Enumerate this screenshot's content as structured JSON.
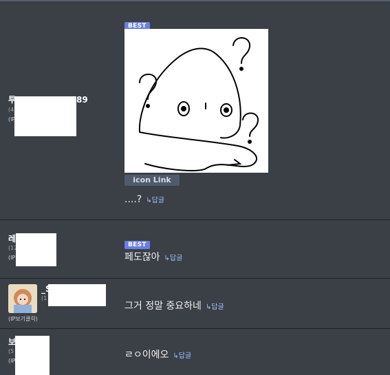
{
  "rows": [
    {
      "user": {
        "name": "투",
        "name_suffix": "89",
        "meta": "(4",
        "ip": "(IP"
      },
      "best_label": "BEST",
      "image_label": "icon Link",
      "text": "....?",
      "reply": "↳답글"
    },
    {
      "user": {
        "name": "레",
        "meta": "(12",
        "ip": "(IP"
      },
      "best_label": "BEST",
      "text": "페도잖아",
      "reply": "↳답글"
    },
    {
      "user": {
        "name": "_S",
        "meta": "(1",
        "ip": "(IP보기클릭)"
      },
      "text": "그거 정말 중요하네",
      "reply": "↳답글"
    },
    {
      "user": {
        "name": "보",
        "meta": "(5",
        "ip": "(IP"
      },
      "text": "ㄹㅇ이에오",
      "reply": "↳답글"
    }
  ],
  "colors": {
    "background": "#3b3f46",
    "best_badge": "#6b7fe0",
    "reply_link": "#9fc3ff"
  },
  "icons": [
    "question-doodle-image",
    "reply-arrow-icon",
    "user-avatar"
  ]
}
